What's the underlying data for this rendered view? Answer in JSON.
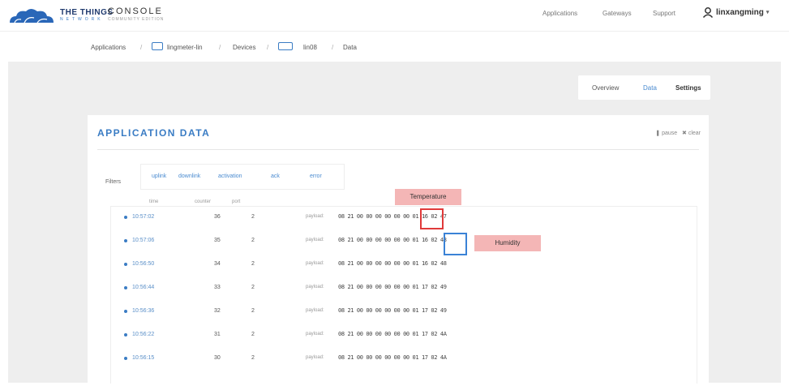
{
  "brand": {
    "line1": "THE THINGS",
    "line2": "NETWORK",
    "console": "CONSOLE",
    "console_sub": "COMMUNITY EDITION"
  },
  "topnav": {
    "applications": "Applications",
    "gateways": "Gateways",
    "support": "Support"
  },
  "user": {
    "name": "linxangming"
  },
  "breadcrumb": {
    "applications": "Applications",
    "app": "lingmeter-lin",
    "devices": "Devices",
    "device": "lin08",
    "data": "Data"
  },
  "tabs": {
    "overview": "Overview",
    "data": "Data",
    "settings": "Settings"
  },
  "card": {
    "title": "APPLICATION DATA",
    "pause": "pause",
    "clear": "clear"
  },
  "filters": {
    "label": "Filters",
    "chips": [
      "uplink",
      "downlink",
      "activation",
      "ack",
      "error"
    ]
  },
  "columns": {
    "time": "time",
    "counter": "counter",
    "port": "port"
  },
  "rows": [
    {
      "time": "10:57:02",
      "counter": "36",
      "port": "2",
      "label": "payload:",
      "payload": "08 21 00 00 00 00 00 00 01 16 02 47"
    },
    {
      "time": "10:57:06",
      "counter": "35",
      "port": "2",
      "label": "payload:",
      "payload": "08 21 00 00 00 00 00 00 01 16 02 48"
    },
    {
      "time": "10:56:50",
      "counter": "34",
      "port": "2",
      "label": "payload:",
      "payload": "08 21 00 00 00 00 00 00 01 16 02 48"
    },
    {
      "time": "10:56:44",
      "counter": "33",
      "port": "2",
      "label": "payload:",
      "payload": "08 21 00 00 00 00 00 00 01 17 02 49"
    },
    {
      "time": "10:56:36",
      "counter": "32",
      "port": "2",
      "label": "payload:",
      "payload": "08 21 00 00 00 00 00 00 01 17 02 49"
    },
    {
      "time": "10:56:22",
      "counter": "31",
      "port": "2",
      "label": "payload:",
      "payload": "08 21 00 00 00 00 00 00 01 17 02 4A"
    },
    {
      "time": "10:56:15",
      "counter": "30",
      "port": "2",
      "label": "payload:",
      "payload": "08 21 00 00 00 00 00 00 01 17 02 4A"
    }
  ],
  "annotations": {
    "temperature": "Temperature",
    "humidity": "Humidity"
  },
  "colors": {
    "accent": "#3a7cc4",
    "annotation_red": "#e03a3a",
    "annotation_blue": "#3a82d6",
    "label_fill": "#f4b6b6"
  }
}
